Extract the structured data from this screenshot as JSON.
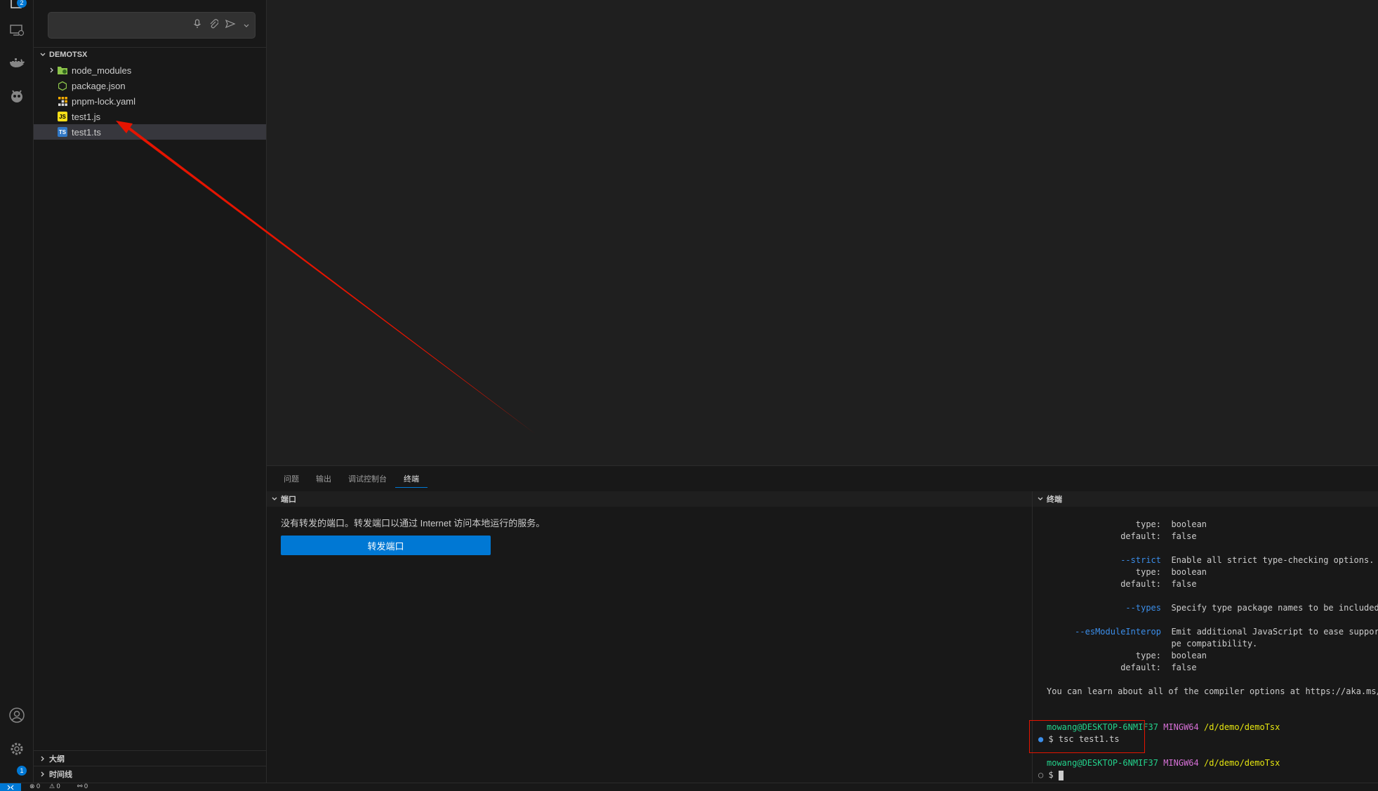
{
  "activity_bar": {
    "explorer_badge": "2",
    "settings_badge": "1"
  },
  "chat": {
    "placeholder": ""
  },
  "explorer": {
    "root": "DEMOTSX",
    "items": [
      {
        "label": "node_modules",
        "icon": "folder-node-icon"
      },
      {
        "label": "package.json",
        "icon": "nodejs-icon"
      },
      {
        "label": "pnpm-lock.yaml",
        "icon": "pnpm-icon"
      },
      {
        "label": "test1.js",
        "icon": "js-file-icon"
      },
      {
        "label": "test1.ts",
        "icon": "ts-file-icon"
      }
    ],
    "outline": "大纲",
    "timeline": "时间线"
  },
  "panel": {
    "tabs": [
      "问题",
      "输出",
      "调试控制台",
      "终端"
    ],
    "active_tab": "终端",
    "ports_header": "端口",
    "ports_message": "没有转发的端口。转发端口以通过 Internet 访问本地运行的服务。",
    "forward_button": "转发端口",
    "terminal_header": "终端"
  },
  "terminal": {
    "lines": [
      {
        "label": "type:",
        "text": "boolean"
      },
      {
        "label": "default:",
        "text": "false"
      },
      {
        "option": "--strict",
        "text": "Enable all strict type-checking options."
      },
      {
        "label": "type:",
        "text": "boolean"
      },
      {
        "label": "default:",
        "text": "false"
      },
      {
        "option": "--types",
        "text": "Specify type package names to be included without being referenced in a source file."
      },
      {
        "option": "--esModuleInterop",
        "text": "Emit additional JavaScript to ease support for importing CommonJS modules. This enables 'allowSyntheticDefaultImports' for ty"
      },
      {
        "label": "",
        "text": "pe compatibility."
      },
      {
        "label": "type:",
        "text": "boolean"
      },
      {
        "label": "default:",
        "text": "false"
      }
    ],
    "learn_more": "You can learn about all of the compiler options at https://aka.ms/tsc",
    "prompt_user": "mowang@DESKTOP-6NMIF37",
    "prompt_env": "MINGW64",
    "prompt_path": "/d/demo/demoTsx",
    "command": "$ tsc test1.ts",
    "prompt_user2": "mowang@DESKTOP-6NMIF37",
    "prompt_env2": "MINGW64",
    "prompt_path2": "/d/demo/demoTsx",
    "current_prompt": "$"
  },
  "status_bar": {
    "errors": "0",
    "warnings": "0",
    "ports": "0"
  },
  "colors": {
    "accent": "#0078d4",
    "annotation": "#e51400"
  }
}
